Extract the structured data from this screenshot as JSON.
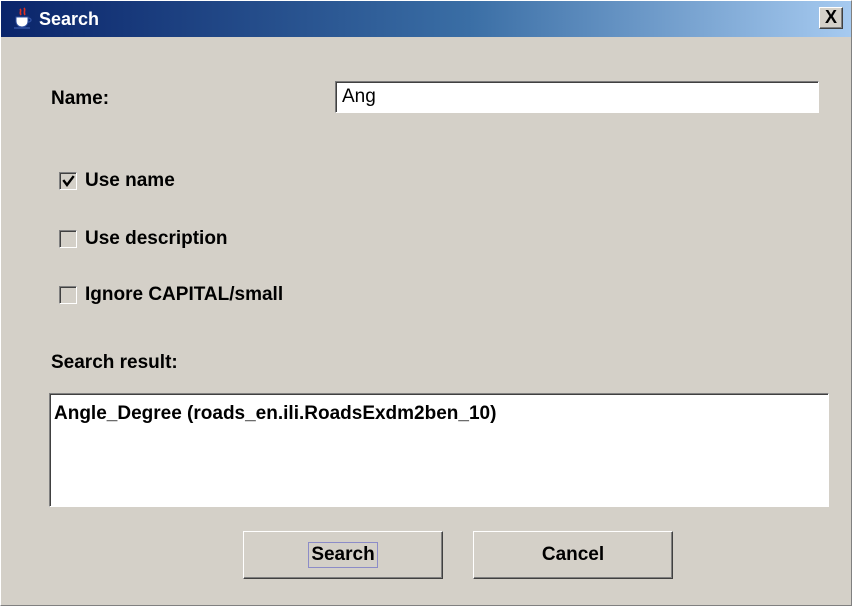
{
  "window": {
    "title": "Search",
    "close_glyph": "X",
    "title_icon": "java-coffee-cup-icon"
  },
  "form": {
    "name_label": "Name:",
    "name_value": "Ang",
    "checkboxes": [
      {
        "label": "Use name",
        "checked": true
      },
      {
        "label": "Use description",
        "checked": false
      },
      {
        "label": "Ignore CAPITAL/small",
        "checked": false
      }
    ],
    "result_label": "Search result:",
    "results": [
      "Angle_Degree (roads_en.ili.RoadsExdm2ben_10)"
    ]
  },
  "buttons": {
    "search_label": "Search",
    "cancel_label": "Cancel"
  },
  "colors": {
    "titlebar_start": "#0a246a",
    "titlebar_end": "#a6caf0",
    "face": "#d4d0c8"
  }
}
